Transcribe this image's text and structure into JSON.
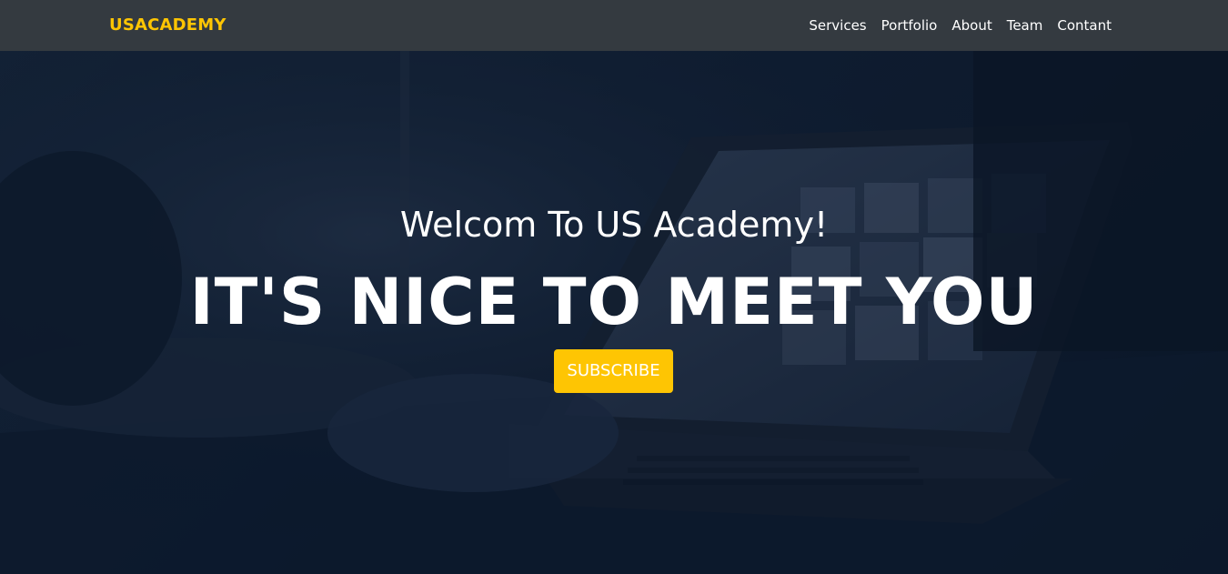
{
  "brand": {
    "name": "USACADEMY"
  },
  "nav": {
    "items": [
      {
        "label": "Services"
      },
      {
        "label": "Portfolio"
      },
      {
        "label": "About"
      },
      {
        "label": "Team"
      },
      {
        "label": "Contant"
      }
    ]
  },
  "hero": {
    "welcome": "Welcom To US Academy!",
    "headline": "IT'S NICE TO MEET YOU",
    "cta_label": "SUBSCRIBE"
  },
  "colors": {
    "brand": "#fec503",
    "navbar_bg": "#343a40",
    "hero_bg": "#0c1a2d",
    "cta_bg": "#fec503"
  },
  "background": {
    "image_subject": "laptop-keyboard-hands-photo"
  }
}
